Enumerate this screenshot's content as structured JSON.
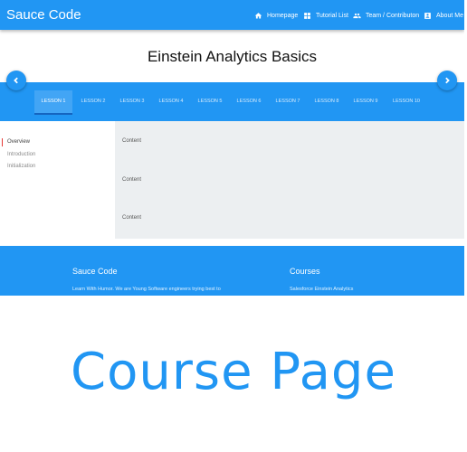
{
  "navbar": {
    "brand": "Sauce Code",
    "items": [
      {
        "label": "Homepage",
        "icon": "home-icon"
      },
      {
        "label": "Tutorial List",
        "icon": "grid-icon"
      },
      {
        "label": "Team / Contributon",
        "icon": "people-icon"
      },
      {
        "label": "About Me",
        "icon": "account-icon"
      }
    ]
  },
  "course": {
    "title": "Einstein Analytics Basics"
  },
  "lessons": {
    "prev_icon": "chevron-left-icon",
    "next_icon": "chevron-right-icon",
    "tabs": [
      "LESSON 1",
      "LESSON 2",
      "LESSON 3",
      "LESSON 4",
      "LESSON 5",
      "LESSON 6",
      "LESSON 7",
      "LESSON 8",
      "LESSON 9",
      "LESSON 10"
    ],
    "active_index": 0
  },
  "sidebar": {
    "items": [
      "Overview",
      "Introduction",
      "Initialization"
    ]
  },
  "content": {
    "blocks": [
      "Content",
      "Content",
      "Content"
    ]
  },
  "footer": {
    "left_heading": "Sauce Code",
    "left_text": "Learn With Humor. We are Young Software engineers trying best to",
    "right_heading": "Courses",
    "right_text": "Salesforce Einstein Analytics"
  },
  "caption": "Course Page",
  "colors": {
    "primary": "#2196f3",
    "content_bg": "#eceff1",
    "active_marker": "#e53935"
  }
}
